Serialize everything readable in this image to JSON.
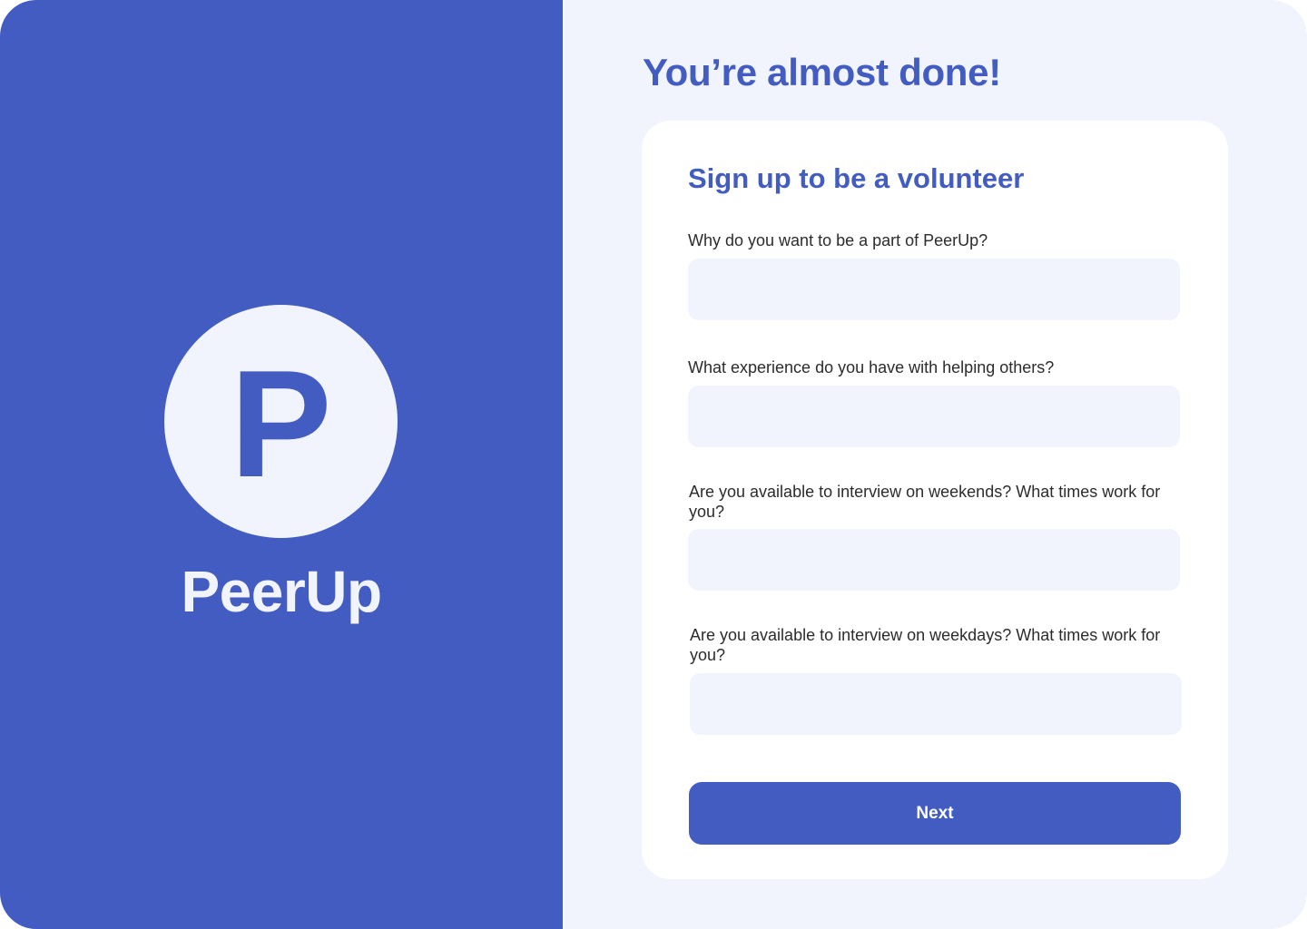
{
  "brand": {
    "logo_letter": "P",
    "name": "PeerUp"
  },
  "header": {
    "title": "You’re almost done!"
  },
  "form": {
    "title": "Sign up to be a volunteer",
    "fields": [
      {
        "label": "Why do you want to be a part of PeerUp?",
        "value": ""
      },
      {
        "label": "What experience do you have with helping others?",
        "value": ""
      },
      {
        "label": "Are you available to interview on weekends? What times work for you?",
        "value": ""
      },
      {
        "label": "Are you available to interview on weekdays? What times work for you?",
        "value": ""
      }
    ],
    "next_label": "Next"
  },
  "colors": {
    "brand_blue": "#425cc2",
    "background_light": "#f1f4fc",
    "card": "#ffffff",
    "label_text": "#2c2c2c"
  }
}
